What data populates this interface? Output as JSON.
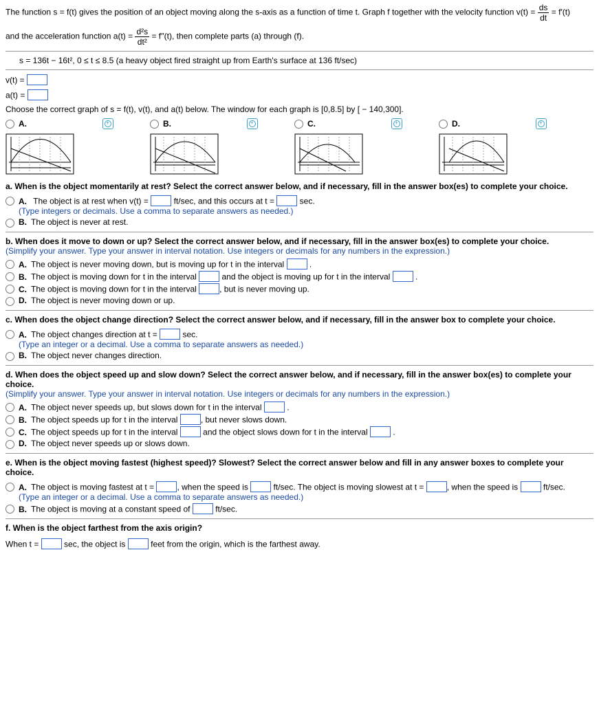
{
  "intro": {
    "p1a": "The function s = f(t) gives the position of an object moving along the s-axis as a function of time t. Graph f together with the velocity function v(t) = ",
    "frac1_top": "ds",
    "frac1_bot": "dt",
    "p1b": " = f′(t)",
    "p2a": "and the acceleration function a(t) = ",
    "frac2_top": "d²s",
    "frac2_bot": "dt²",
    "p2b": " = f′′(t), then complete parts (a) through (f).",
    "eq": "s = 136t − 16t², 0 ≤ t ≤ 8.5 (a heavy object fired straight up from Earth's surface at 136 ft/sec)"
  },
  "vprompt": "v(t) =",
  "aprompt": "a(t) =",
  "choosegraph": "Choose the correct graph of s = f(t), v(t), and a(t) below. The window for each graph is [0,8.5] by [ − 140,300].",
  "gopt": {
    "A": "A.",
    "B": "B.",
    "C": "C.",
    "D": "D."
  },
  "qa": {
    "prompt": "a. When is the object momentarily at rest? Select the correct answer below, and if necessary, fill in the answer box(es) to complete your choice.",
    "A1": "The object is at rest when v(t) =",
    "A2": "ft/sec, and this occurs at t =",
    "A3": "sec.",
    "Anote": "(Type integers or decimals. Use a comma to separate answers as needed.)",
    "B": "The object is never at rest."
  },
  "qb": {
    "prompt": "b. When does it move to down or up? Select the correct answer below, and if necessary, fill in the answer box(es) to complete your choice.",
    "note": "(Simplify your answer. Type your answer in interval notation. Use integers or decimals for any numbers in the expression.)",
    "A1": "The object is never moving down, but is moving up for t in the interval",
    "B1": "The object is moving down for t in the interval",
    "B2": "and the object is moving up for t in the interval",
    "C1": "The object is moving down for t in the interval",
    "C2": ", but is never moving up.",
    "D": "The object is never moving down or up."
  },
  "qc": {
    "prompt": "c. When does the object change direction? Select the correct answer below, and if necessary, fill in the answer box to complete your choice.",
    "A1": "The object changes direction at t =",
    "A2": "sec.",
    "Anote": "(Type an integer or a decimal. Use a comma to separate answers as needed.)",
    "B": "The object never changes direction."
  },
  "qd": {
    "prompt": "d. When does the object speed up and slow down? Select the correct answer below, and if necessary, fill in the answer box(es) to complete your choice.",
    "note": "(Simplify your answer. Type your answer in interval notation. Use integers or decimals for any numbers in the expression.)",
    "A": "The object never speeds up, but slows down for t in the interval",
    "B": "The object speeds up for t in the interval",
    "B2": ", but never slows down.",
    "C1": "The object speeds up for t in the interval",
    "C2": "and the object slows down for t in the interval",
    "D": "The object never speeds up or slows down."
  },
  "qe": {
    "prompt": "e. When is the object moving fastest (highest speed)? Slowest? Select the correct answer below and fill in any answer boxes to complete your choice.",
    "A1": "The object is moving fastest at t =",
    "A2": ", when the speed is",
    "A3": "ft/sec. The object is moving slowest at t =",
    "A4": ", when the speed is",
    "A5": "ft/sec.",
    "Anote": "(Type an integer or a decimal. Use a comma to separate answers as needed.)",
    "B1": "The object is moving at a constant speed of",
    "B2": "ft/sec."
  },
  "qf": {
    "prompt": "f. When is the object farthest from the axis origin?",
    "l1": "When t =",
    "l2": "sec, the object is",
    "l3": "feet from the origin, which is the farthest away."
  },
  "lbl": {
    "A": "A.",
    "B": "B.",
    "C": "C.",
    "D": "D."
  },
  "period": "."
}
